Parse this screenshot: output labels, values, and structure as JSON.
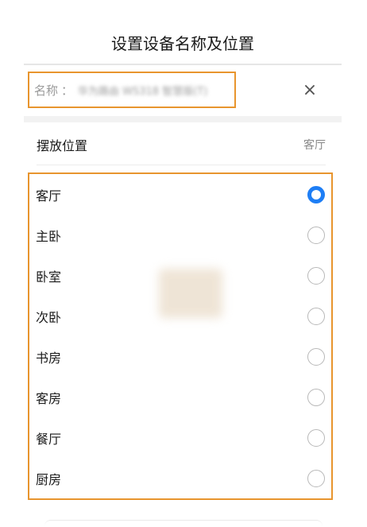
{
  "header": {
    "title": "设置设备名称及位置"
  },
  "name_field": {
    "label": "名称",
    "colon": "：",
    "value": "华为路由 WS318 智慧版(T)",
    "clear_icon": "close-icon",
    "clear_glyph": "×"
  },
  "location": {
    "title": "摆放位置",
    "current": "客厅",
    "options": [
      {
        "label": "客厅",
        "selected": true
      },
      {
        "label": "主卧",
        "selected": false
      },
      {
        "label": "卧室",
        "selected": false
      },
      {
        "label": "次卧",
        "selected": false
      },
      {
        "label": "书房",
        "selected": false
      },
      {
        "label": "客房",
        "selected": false
      },
      {
        "label": "餐厅",
        "selected": false
      },
      {
        "label": "厨房",
        "selected": false
      }
    ]
  },
  "colors": {
    "highlight_border": "#e8952e",
    "radio_selected": "#1e7ef5"
  }
}
